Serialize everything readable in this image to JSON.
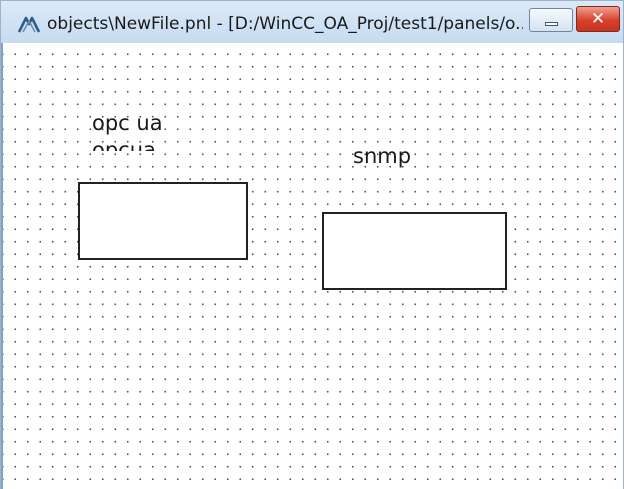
{
  "window": {
    "title": "objects\\NewFile.pnl - [D:/WinCC_OA_Proj/test1/panels/o...",
    "app_icon": "wincc-oa-icon",
    "minimize_icon": "minimize-icon",
    "close_icon": "close-icon",
    "close_glyph": "✕"
  },
  "canvas": {
    "grid": true,
    "labels": {
      "opc_ua": "opc ua",
      "opc_ua_clipped": "opcua",
      "snmp": "snmp"
    }
  },
  "colors": {
    "close_button": "#c7321d",
    "titlebar": "#c6dbf1"
  }
}
